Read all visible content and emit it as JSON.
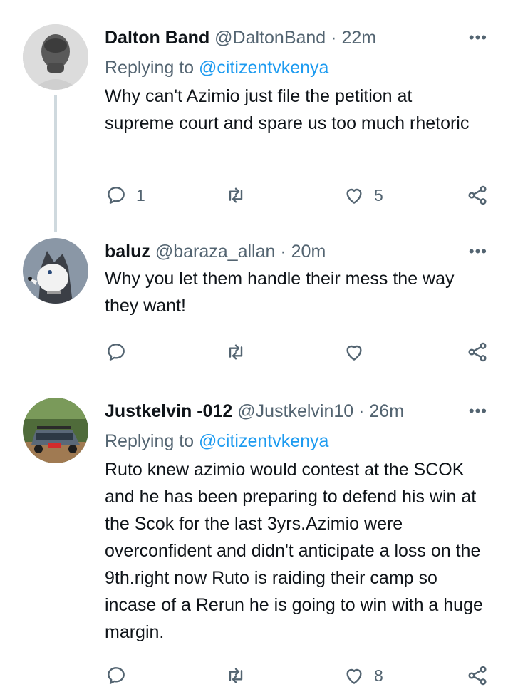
{
  "tweets": [
    {
      "name": "Dalton Band",
      "handle": "@DaltonBand",
      "time": "22m",
      "replying_prefix": "Replying to",
      "replying_to": "@citizentvkenya",
      "text": "Why can't Azimio just file the petition at supreme court and spare us too much rhetoric",
      "reply_count": "1",
      "retweet_count": "",
      "like_count": "5"
    },
    {
      "name": "baluz",
      "handle": "@baraza_allan",
      "time": "20m",
      "text": "Why you let them handle their mess the way they want!",
      "reply_count": "",
      "retweet_count": "",
      "like_count": ""
    },
    {
      "name": "Justkelvin -012",
      "handle": "@Justkelvin10",
      "time": "26m",
      "replying_prefix": "Replying to",
      "replying_to": "@citizentvkenya",
      "text": "Ruto knew azimio would contest at the SCOK  and he has been preparing to defend his win at the Scok for the last 3yrs.Azimio were overconfident and didn't anticipate a loss on the 9th.right now Ruto is raiding their camp so incase of a Rerun he is going to win with a huge margin.",
      "reply_count": "",
      "retweet_count": "",
      "like_count": "8"
    }
  ],
  "ui": {
    "dot": "·",
    "more_glyph": "•••"
  },
  "colors": {
    "accent": "#1d9bf0",
    "secondary_text": "#536471",
    "thread_line": "#cfd9de"
  }
}
